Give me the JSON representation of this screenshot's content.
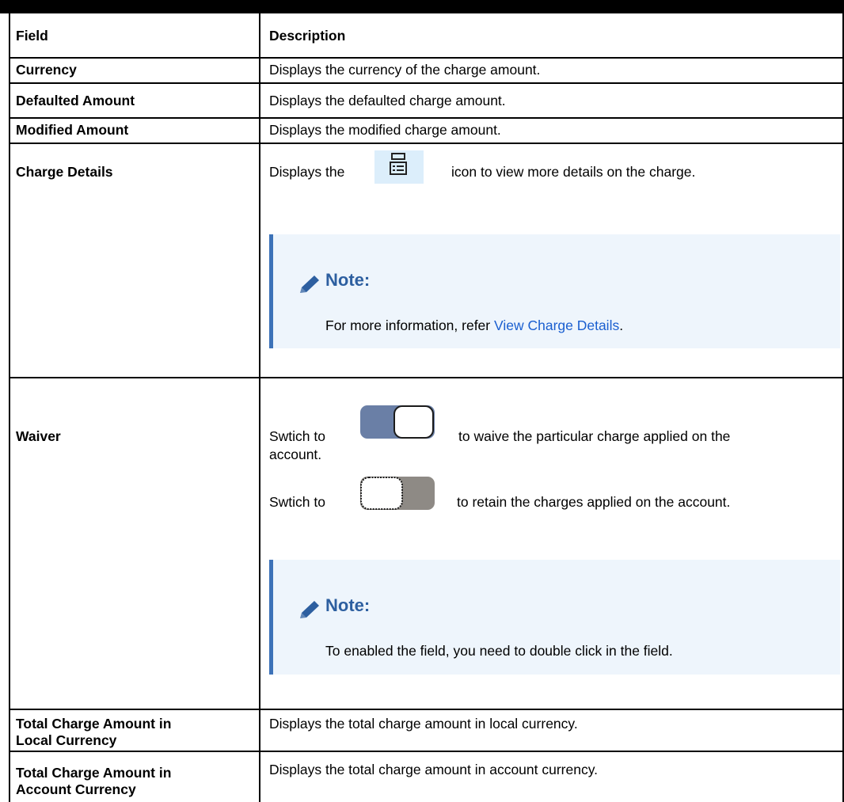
{
  "table": {
    "headers": {
      "field": "Field",
      "description": "Description"
    },
    "rows": [
      {
        "field": "Currency",
        "description": "Displays the currency of the charge amount."
      },
      {
        "field": "Defaulted Amount",
        "description": "Displays the defaulted charge amount."
      },
      {
        "field": "Modified Amount",
        "description": "Displays the modified charge amount."
      },
      {
        "field": "Charge Details",
        "desc_before": "Displays the",
        "desc_after": "icon to view more details on the charge.",
        "icon": "charge-details-icon",
        "note": {
          "title": "Note:",
          "text_before": "For more information, refer ",
          "link": "View Charge Details",
          "text_after": "."
        }
      },
      {
        "field": "Waiver",
        "line1_before": "Swtich to",
        "line1_after": "to waive the particular charge applied on the",
        "line1_cont": "account.",
        "line2_before": "Swtich to",
        "line2_after": "to retain the charges applied on the account.",
        "note": {
          "title": "Note:",
          "text": "To enabled the field, you need to double click in the field."
        }
      },
      {
        "field_l1": "Total Charge Amount in",
        "field_l2": "Local Currency",
        "description": "Displays the total charge amount in local currency."
      },
      {
        "field_l1": "Total Charge Amount in",
        "field_l2": "Account Currency",
        "description": "Displays the total charge amount in account currency."
      }
    ]
  },
  "colors": {
    "note_bg": "#eef5fc",
    "note_bar": "#3d72b8",
    "note_title": "#2d5fa0",
    "link": "#1a5fd0",
    "toggle_on": "#6a7fa6",
    "toggle_off": "#8e8a85"
  }
}
